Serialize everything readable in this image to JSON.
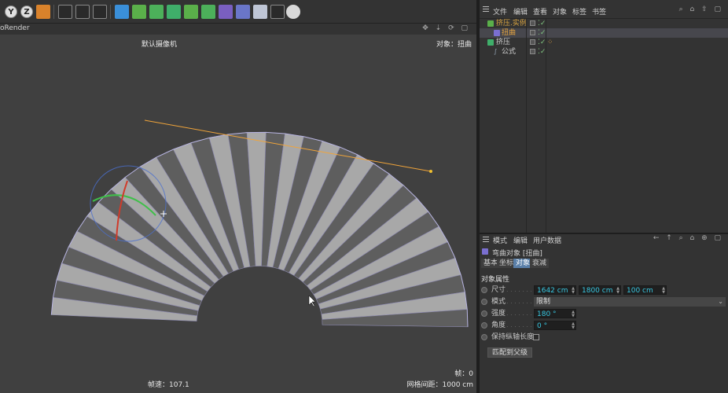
{
  "viewport": {
    "title": "oRender",
    "camera_label": "默认摄像机",
    "object_label": "对象：扭曲",
    "fps_label": "帧速：107.1",
    "grid_label": "网格间距：1000 cm",
    "frame_label": "帧：0"
  },
  "toolbar": {
    "axis_y": "Y",
    "axis_z": "Z"
  },
  "object_manager": {
    "menu": [
      "文件",
      "编辑",
      "查看",
      "对象",
      "标签",
      "书签"
    ],
    "tree": [
      {
        "name": "挤压.实例",
        "color": "#d9a441"
      },
      {
        "name": "扭曲",
        "color": "#e8a640"
      },
      {
        "name": "挤压",
        "color": "#d0d0d0"
      },
      {
        "name": "公式",
        "color": "#d0d0d0"
      }
    ]
  },
  "attribute_manager": {
    "menu": [
      "模式",
      "编辑",
      "用户数据"
    ],
    "title": "弯曲对象 [扭曲]",
    "tabs": [
      "基本",
      "坐标",
      "对象",
      "衰减"
    ],
    "section_title": "对象属性",
    "size_label": "尺寸",
    "size_x": "1642 cm",
    "size_y": "1800 cm",
    "size_z": "100 cm",
    "mode_label": "模式",
    "mode_value": "限制",
    "strength_label": "强度",
    "strength_value": "180 °",
    "angle_label": "角度",
    "angle_value": "0 °",
    "keep_length_label": "保持纵轴长度",
    "fit_button": "匹配到父级"
  },
  "colors": {
    "accent_blue": "#37c6e0",
    "tab_active": "#5a7fa8",
    "bend_orange": "#f0a43a",
    "fan_light": "#a8a8a8",
    "fan_dark": "#5e5e5e"
  }
}
